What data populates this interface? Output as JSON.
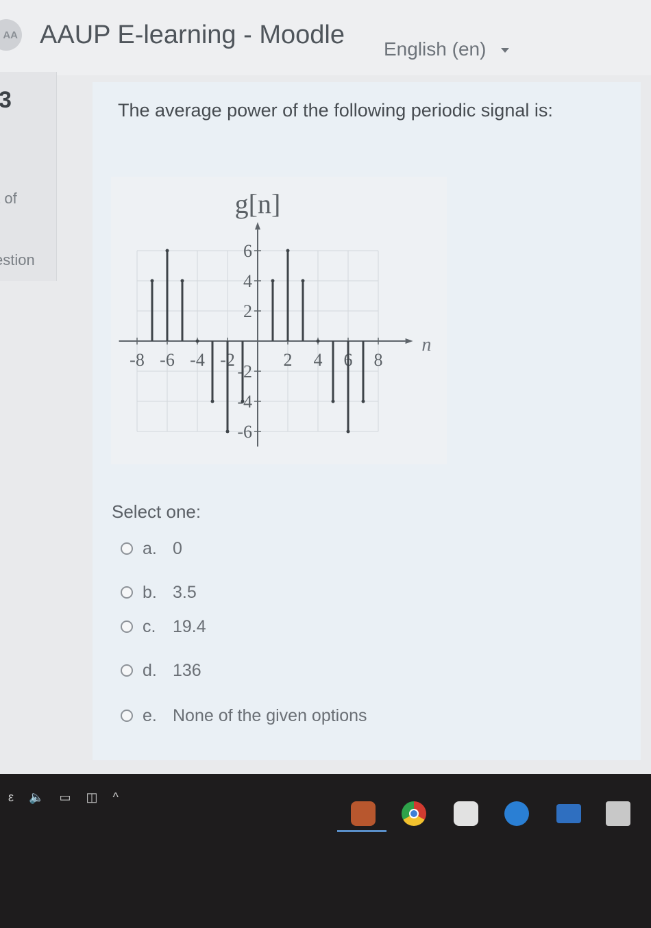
{
  "header": {
    "logo_text": "AA",
    "site_title": "AAUP E-learning - Moodle",
    "language": "English (en)"
  },
  "question_info": {
    "number": "3",
    "mark_label": "ıt of",
    "flag_label": "estion"
  },
  "question": {
    "text": "The average power of the following periodic signal is:",
    "select_label": "Select one:",
    "options": [
      {
        "letter": "a.",
        "value": "0"
      },
      {
        "letter": "b.",
        "value": "3.5"
      },
      {
        "letter": "c.",
        "value": "19.4"
      },
      {
        "letter": "d.",
        "value": "136"
      },
      {
        "letter": "e.",
        "value": "None of the given options"
      }
    ]
  },
  "chart_data": {
    "type": "stem",
    "title": "g[n]",
    "xlabel": "n",
    "ylabel": "",
    "x_ticks": [
      "-8",
      "-6",
      "-4",
      "-2",
      "2",
      "4",
      "6",
      "8"
    ],
    "y_ticks_pos": [
      "2",
      "4",
      "6"
    ],
    "y_ticks_neg": [
      "-2",
      "-4",
      "-6"
    ],
    "xlim": [
      -9,
      9
    ],
    "ylim": [
      -7,
      7
    ],
    "grid": true,
    "x": [
      -7,
      -6,
      -5,
      -4,
      -3,
      -2,
      -1,
      1,
      2,
      3,
      4,
      5,
      6,
      7
    ],
    "y": [
      4,
      6,
      4,
      0,
      -4,
      -6,
      -4,
      4,
      6,
      4,
      0,
      -4,
      -6,
      -4
    ]
  },
  "taskbar": {
    "tray_glyphs": [
      "ε",
      "🔈",
      "▭",
      "◫",
      "^"
    ],
    "colors": {
      "edge": "#2a7fd4",
      "chrome_red": "#d23b30",
      "mail": "#2f6fc0",
      "store": "#c8c8c8"
    },
    "apps": [
      "weather-icon",
      "chrome-icon",
      "app-icon",
      "edge-icon",
      "mail-icon",
      "store-icon"
    ]
  }
}
